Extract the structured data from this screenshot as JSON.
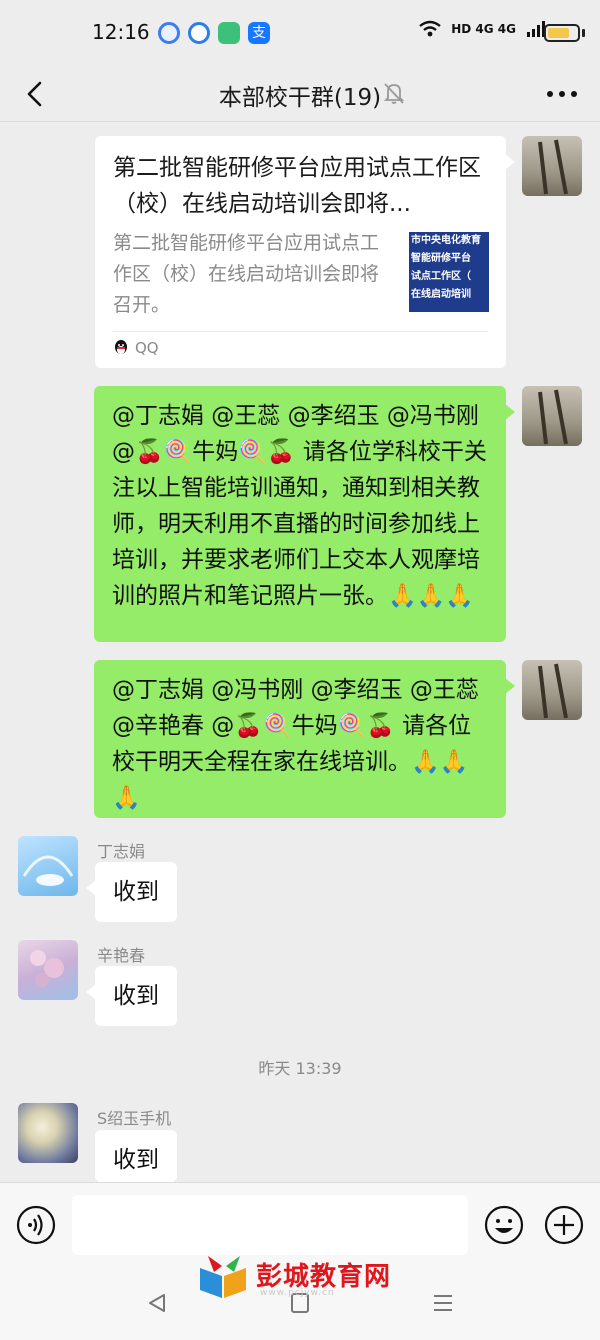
{
  "status_bar": {
    "time": "12:16",
    "network": "HD 4G 4G"
  },
  "header": {
    "title": "本部校干群(19)"
  },
  "messages": {
    "card": {
      "title": "第二批智能研修平台应用试点工作区（校）在线启动培训会即将...",
      "description": "第二批智能研修平台应用试点工作区（校）在线启动培训会即将召开。",
      "thumb_lines": [
        "市中央电化教育",
        "智能研修平台",
        "试点工作区（",
        "在线启动培训"
      ],
      "source": "QQ"
    },
    "msg1": "@丁志娟 @王蕊 @李绍玉 @冯书刚 @🍒🍭牛妈🍭🍒 请各位学科校干关注以上智能培训通知，通知到相关教师，明天利用不直播的时间参加线上培训，并要求老师们上交本人观摩培训的照片和笔记照片一张。🙏🙏🙏",
    "msg2": "@丁志娟 @冯书刚 @李绍玉 @王蕊 @辛艳春 @🍒🍭牛妈🍭🍒 请各位校干明天全程在家在线培训。🙏🙏🙏",
    "reply1": {
      "sender": "丁志娟",
      "text": "收到"
    },
    "reply2": {
      "sender": "辛艳春",
      "text": "收到"
    },
    "timestamp": "昨天 13:39",
    "reply3": {
      "sender": "S绍玉手机",
      "text": "收到"
    }
  },
  "input": {
    "placeholder": ""
  },
  "watermark": {
    "text": "彭城教育网",
    "url": "www.pcjyw.cn"
  },
  "colors": {
    "background": "#ededed",
    "bubble_green": "#95ec69",
    "bubble_white": "#ffffff",
    "watermark_red": "#e0161d"
  },
  "icons": [
    "back-arrow-icon",
    "mute-bell-icon",
    "more-icon",
    "voice-icon",
    "emoji-icon",
    "plus-icon",
    "qq-icon"
  ]
}
